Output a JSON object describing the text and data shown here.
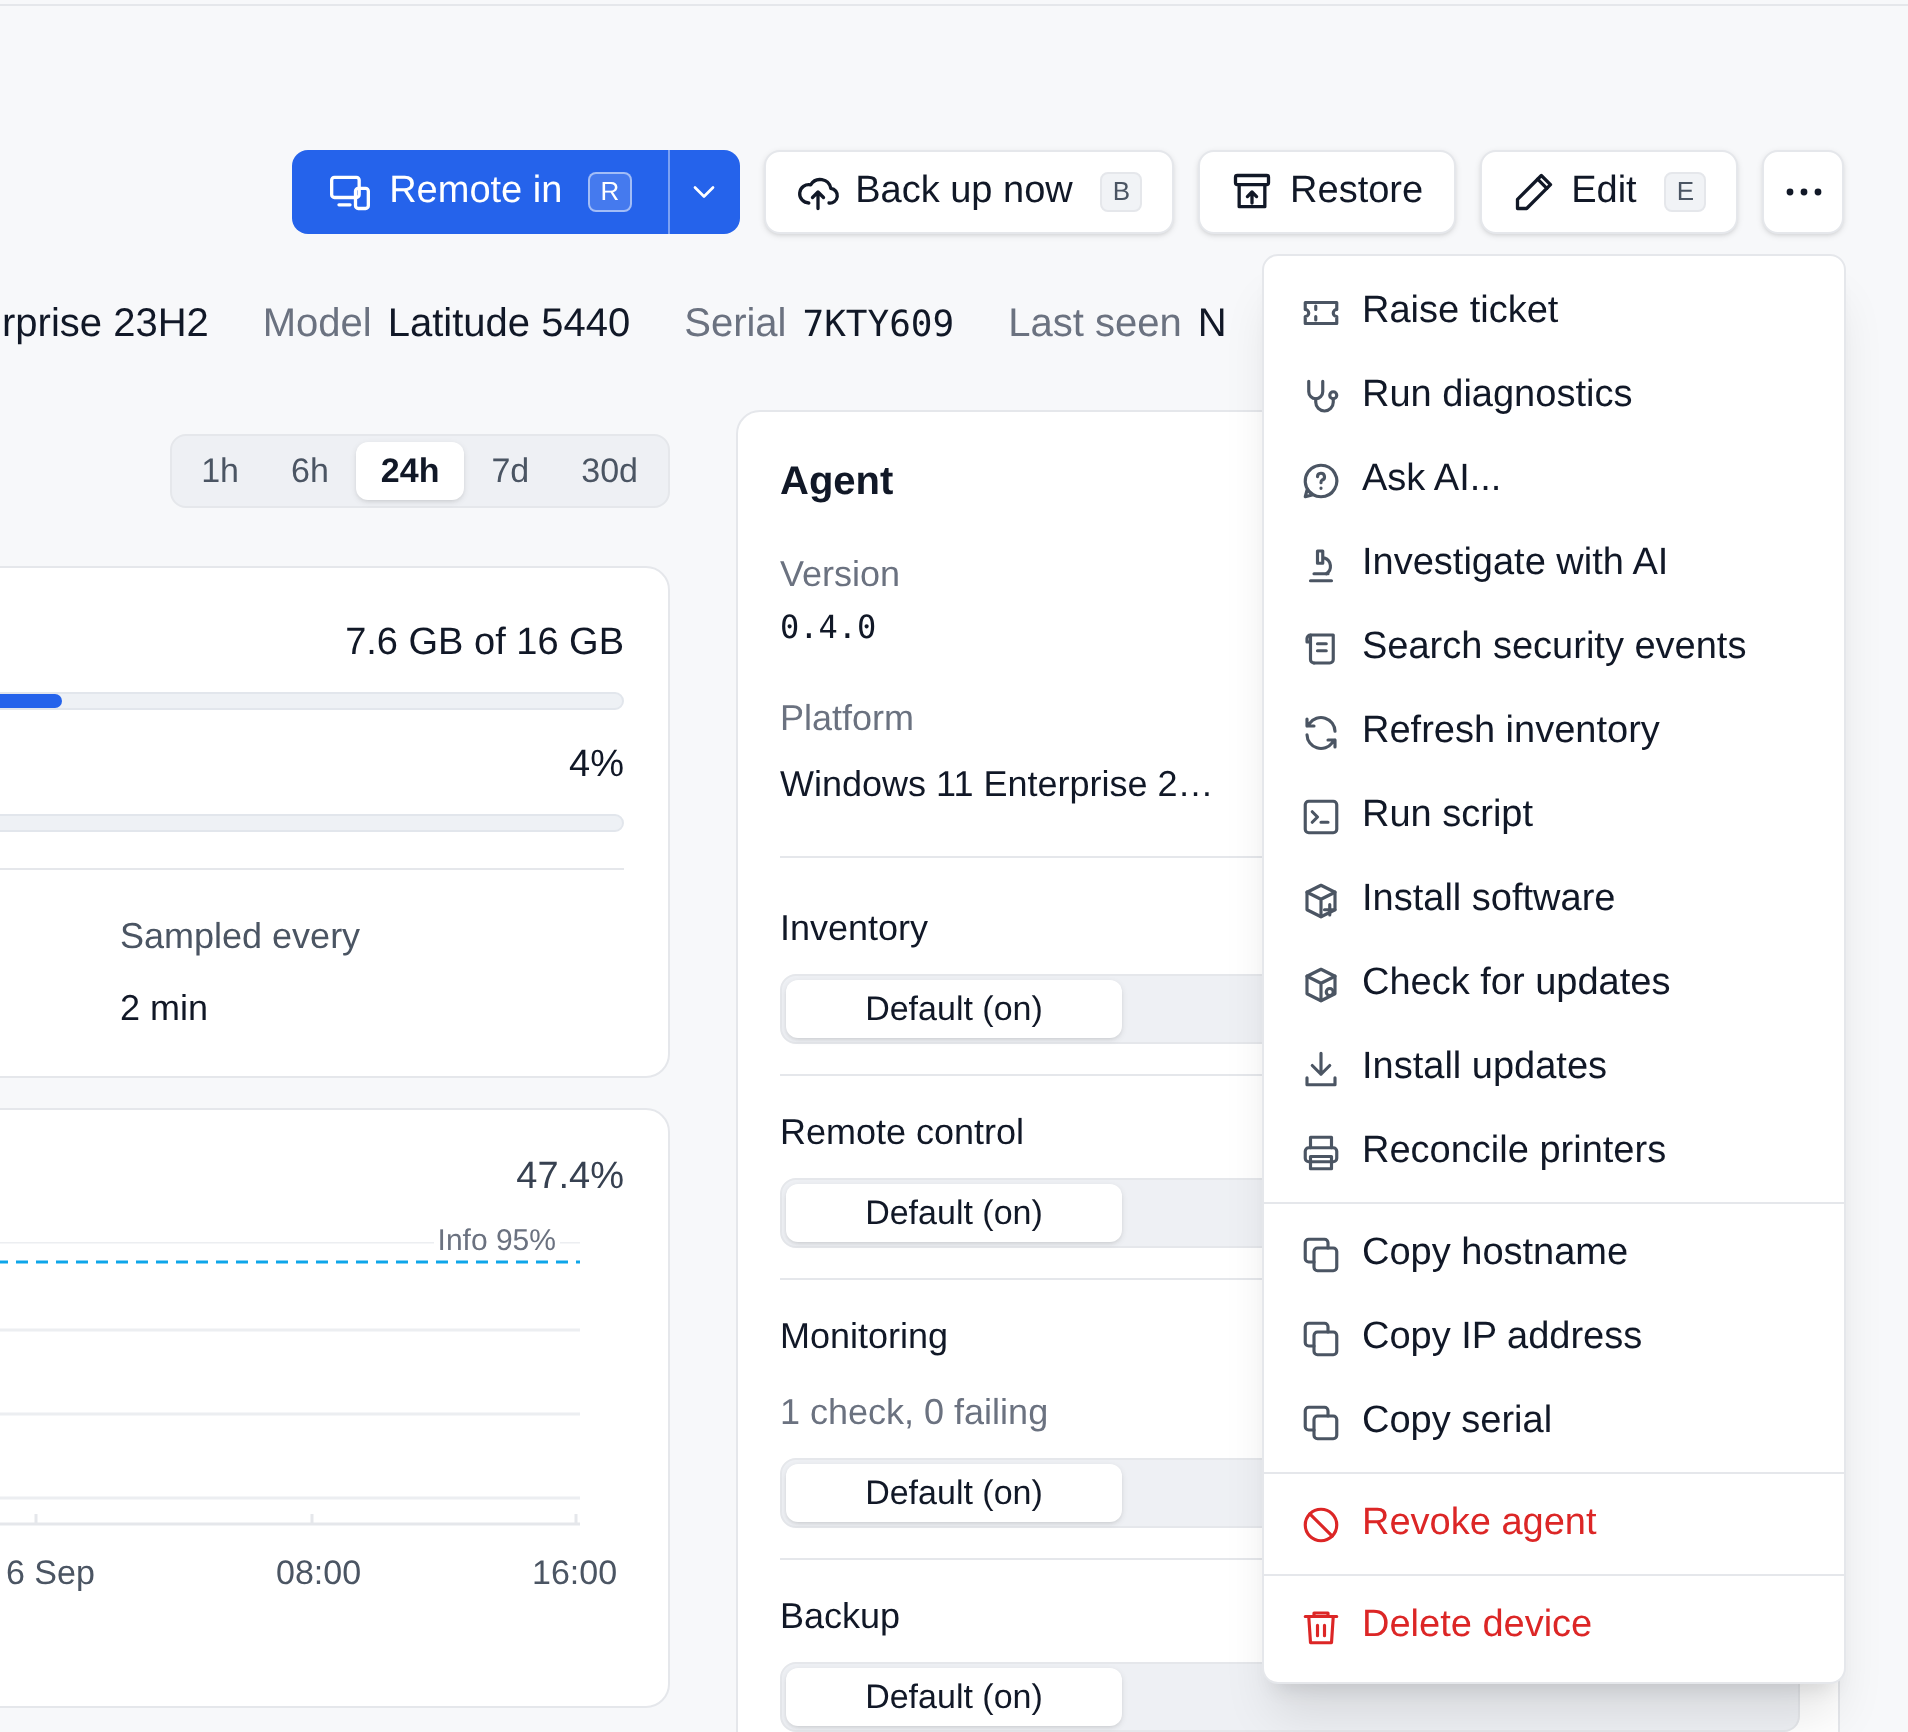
{
  "toolbar": {
    "buttons": [
      {
        "kind": "split",
        "label": "Remote in",
        "shortcut": "R"
      },
      {
        "kind": "plain",
        "label": "Back up now",
        "shortcut": "B"
      },
      {
        "kind": "plain",
        "label": "Restore"
      },
      {
        "kind": "plain",
        "label": "Edit",
        "shortcut": "E"
      },
      {
        "kind": "more"
      }
    ]
  },
  "meta": [
    {
      "value": "rprise 23H2"
    },
    {
      "label": "Model",
      "value": "Latitude 5440"
    },
    {
      "label": "Serial",
      "value": "7KTY609",
      "kind": "mono"
    },
    {
      "label": "Last seen",
      "value": "N"
    }
  ],
  "time_range": [
    {
      "label": "1h",
      "selected": false
    },
    {
      "label": "6h",
      "selected": false
    },
    {
      "label": "24h",
      "selected": true
    },
    {
      "label": "7d",
      "selected": false
    },
    {
      "label": "30d",
      "selected": false
    }
  ],
  "usage_card": {
    "meters": [
      {
        "reading": "7.6 GB of 16 GB",
        "level": 0.535
      },
      {
        "reading": "4%"
      }
    ],
    "sampled": {
      "label": "Sampled every",
      "value": "2 min"
    }
  },
  "chart_card": {
    "reading": "47.4%",
    "threshold_label": "Info 95%",
    "x_labels": [
      "6 Sep",
      "08:00",
      "16:00"
    ]
  },
  "agent": {
    "title": "Agent",
    "fields": [
      {
        "label": "Version",
        "value": "0.4.0",
        "kind": "mono"
      },
      {
        "label": "Platform",
        "value": "Windows 11 Enterprise 2…",
        "kind": "text"
      }
    ],
    "sections": [
      {
        "title": "Inventory",
        "options": [
          {
            "label": "Default (on)",
            "selected": true
          }
        ]
      },
      {
        "title": "Remote control",
        "options": [
          {
            "label": "Default (on)",
            "selected": true
          }
        ]
      },
      {
        "title": "Monitoring",
        "note": "1 check, 0 failing",
        "options": [
          {
            "label": "Default (on)",
            "selected": true
          }
        ]
      },
      {
        "title": "Backup",
        "options": [
          {
            "label": "Default (on)",
            "selected": true
          }
        ]
      }
    ]
  },
  "menu": {
    "groups": [
      [
        {
          "label": "Raise ticket",
          "kind": "normal"
        },
        {
          "label": "Run diagnostics",
          "kind": "normal"
        },
        {
          "label": "Ask AI...",
          "kind": "normal"
        },
        {
          "label": "Investigate with AI",
          "kind": "normal"
        },
        {
          "label": "Search security events",
          "kind": "normal"
        },
        {
          "label": "Refresh inventory",
          "kind": "normal"
        },
        {
          "label": "Run script",
          "kind": "normal"
        },
        {
          "label": "Install software",
          "kind": "normal"
        },
        {
          "label": "Check for updates",
          "kind": "normal"
        },
        {
          "label": "Install updates",
          "kind": "normal"
        },
        {
          "label": "Reconcile printers",
          "kind": "normal"
        }
      ],
      [
        {
          "label": "Copy hostname",
          "kind": "normal"
        },
        {
          "label": "Copy IP address",
          "kind": "normal"
        },
        {
          "label": "Copy serial",
          "kind": "normal"
        }
      ],
      [
        {
          "label": "Revoke agent",
          "kind": "danger"
        }
      ],
      [
        {
          "label": "Delete device",
          "kind": "danger"
        }
      ]
    ]
  }
}
